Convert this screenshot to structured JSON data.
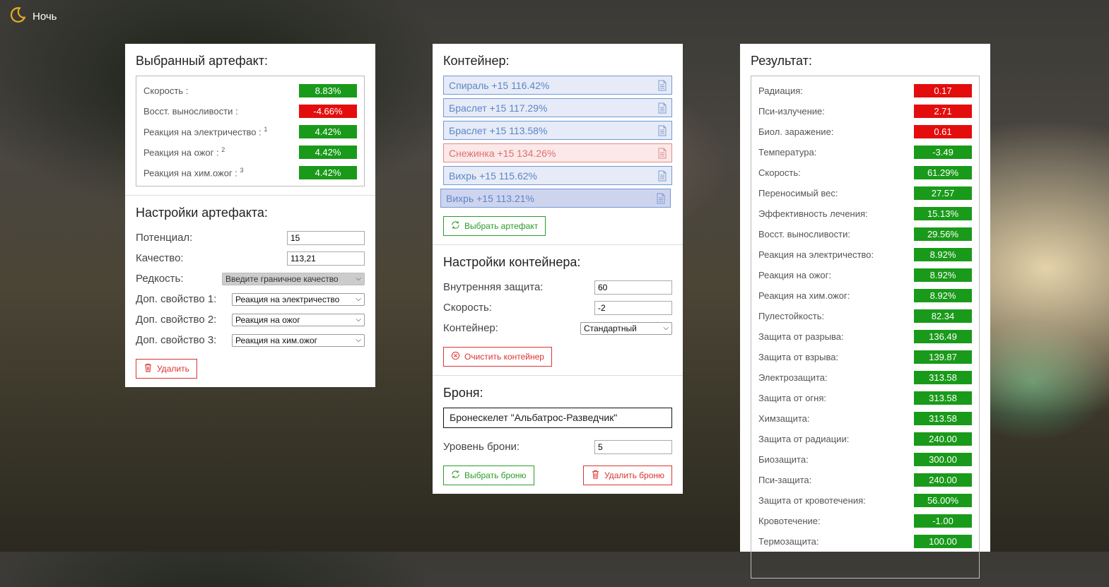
{
  "theme_toggle": {
    "label": "Ночь",
    "icon": "moon-icon"
  },
  "artifact_panel": {
    "title": "Выбранный артефакт:",
    "stats": [
      {
        "label": "Скорость :",
        "sup": "",
        "value": "8.83%",
        "status": "positive"
      },
      {
        "label": "Восст. выносливости :",
        "sup": "",
        "value": "-4.66%",
        "status": "negative"
      },
      {
        "label": "Реакция на электричество :",
        "sup": "1",
        "value": "4.42%",
        "status": "positive"
      },
      {
        "label": "Реакция на ожог :",
        "sup": "2",
        "value": "4.42%",
        "status": "positive"
      },
      {
        "label": "Реакция на хим.ожог :",
        "sup": "3",
        "value": "4.42%",
        "status": "positive"
      }
    ],
    "settings_title": "Настройки артефакта:",
    "potential": {
      "label": "Потенциал:",
      "value": "15"
    },
    "quality": {
      "label": "Качество:",
      "value": "113,21"
    },
    "rarity": {
      "label": "Редкость:",
      "value": "Введите граничное качество"
    },
    "extra1": {
      "label": "Доп. свойство 1:",
      "value": "Реакция на электричество"
    },
    "extra2": {
      "label": "Доп. свойство 2:",
      "value": "Реакция на ожог"
    },
    "extra3": {
      "label": "Доп. свойство 3:",
      "value": "Реакция на хим.ожог"
    },
    "delete_label": "Удалить"
  },
  "container_panel": {
    "title": "Контейнер:",
    "items": [
      {
        "label": "Спираль +15 116.42%",
        "state": "normal"
      },
      {
        "label": "Браслет +15 117.29%",
        "state": "normal"
      },
      {
        "label": "Браслет +15 113.58%",
        "state": "normal"
      },
      {
        "label": "Снежинка +15 134.26%",
        "state": "warning"
      },
      {
        "label": "Вихрь +15 115.62%",
        "state": "normal"
      },
      {
        "label": "Вихрь +15 113.21%",
        "state": "selected"
      }
    ],
    "select_artifact_label": "Выбрать артефакт",
    "settings_title": "Настройки контейнера:",
    "inner_protection": {
      "label": "Внутренняя защита:",
      "value": "60"
    },
    "speed": {
      "label": "Скорость:",
      "value": "-2"
    },
    "container_type": {
      "label": "Контейнер:",
      "value": "Стандартный"
    },
    "clear_label": "Очистить контейнер",
    "armor_title": "Броня:",
    "armor_name": "Бронескелет \"Альбатрос-Разведчик\"",
    "armor_level": {
      "label": "Уровень брони:",
      "value": "5"
    },
    "select_armor_label": "Выбрать броню",
    "delete_armor_label": "Удалить броню"
  },
  "result_panel": {
    "title": "Результат:",
    "stats": [
      {
        "label": "Радиация:",
        "value": "0.17",
        "status": "negative"
      },
      {
        "label": "Пси-излучение:",
        "value": "2.71",
        "status": "negative"
      },
      {
        "label": "Биол. заражение:",
        "value": "0.61",
        "status": "negative"
      },
      {
        "label": "Температура:",
        "value": "-3.49",
        "status": "positive"
      },
      {
        "label": "Скорость:",
        "value": "61.29%",
        "status": "positive"
      },
      {
        "label": "Переносимый вес:",
        "value": "27.57",
        "status": "positive"
      },
      {
        "label": "Эффективность лечения:",
        "value": "15.13%",
        "status": "positive"
      },
      {
        "label": "Восст. выносливости:",
        "value": "29.56%",
        "status": "positive"
      },
      {
        "label": "Реакция на электричество:",
        "value": "8.92%",
        "status": "positive"
      },
      {
        "label": "Реакция на ожог:",
        "value": "8.92%",
        "status": "positive"
      },
      {
        "label": "Реакция на хим.ожог:",
        "value": "8.92%",
        "status": "positive"
      },
      {
        "label": "Пулестойкость:",
        "value": "82.34",
        "status": "positive"
      },
      {
        "label": "Защита от разрыва:",
        "value": "136.49",
        "status": "positive"
      },
      {
        "label": "Защита от взрыва:",
        "value": "139.87",
        "status": "positive"
      },
      {
        "label": "Электрозащита:",
        "value": "313.58",
        "status": "positive"
      },
      {
        "label": "Защита от огня:",
        "value": "313.58",
        "status": "positive"
      },
      {
        "label": "Химзащита:",
        "value": "313.58",
        "status": "positive"
      },
      {
        "label": "Защита от радиации:",
        "value": "240.00",
        "status": "positive"
      },
      {
        "label": "Биозащита:",
        "value": "300.00",
        "status": "positive"
      },
      {
        "label": "Пси-защита:",
        "value": "240.00",
        "status": "positive"
      },
      {
        "label": "Защита от кровотечения:",
        "value": "56.00%",
        "status": "positive"
      },
      {
        "label": "Кровотечение:",
        "value": "-1.00",
        "status": "positive"
      },
      {
        "label": "Термозащита:",
        "value": "100.00",
        "status": "positive"
      }
    ]
  },
  "colors": {
    "positive": "#1a9a1a",
    "negative": "#e40d0d",
    "accent_blue": "#5c86c8"
  }
}
